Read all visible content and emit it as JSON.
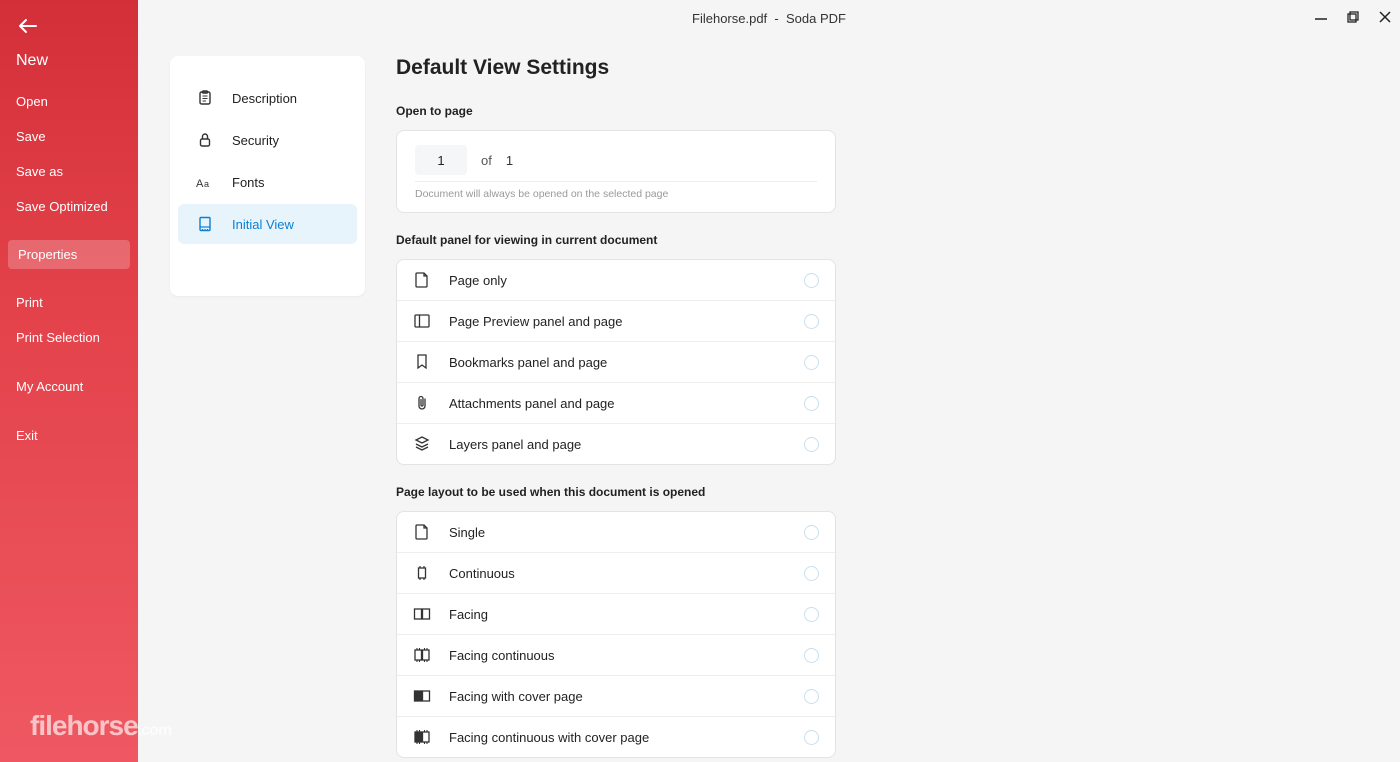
{
  "titlebar": {
    "document": "Filehorse.pdf",
    "separator": "-",
    "app": "Soda PDF"
  },
  "sidebar": {
    "items": [
      {
        "label": "New",
        "big": true
      },
      {
        "label": "Open"
      },
      {
        "label": "Save"
      },
      {
        "label": "Save as"
      },
      {
        "label": "Save Optimized"
      },
      {
        "label": "Properties",
        "active": true
      },
      {
        "label": "Print"
      },
      {
        "label": "Print Selection"
      },
      {
        "label": "My Account"
      },
      {
        "label": "Exit"
      }
    ]
  },
  "tabs": [
    {
      "label": "Description"
    },
    {
      "label": "Security"
    },
    {
      "label": "Fonts"
    },
    {
      "label": "Initial View",
      "active": true
    }
  ],
  "content": {
    "heading": "Default View Settings",
    "open_to_page": {
      "label": "Open to page",
      "value": "1",
      "of_text": "of",
      "total": "1",
      "hint": "Document will always be opened on the selected page"
    },
    "panel_section": {
      "label": "Default panel for viewing in current document",
      "options": [
        "Page only",
        "Page Preview panel and page",
        "Bookmarks panel and page",
        "Attachments panel and page",
        "Layers panel and page"
      ]
    },
    "layout_section": {
      "label": "Page layout to be used when this document is opened",
      "options": [
        "Single",
        "Continuous",
        "Facing",
        "Facing continuous",
        "Facing with cover page",
        "Facing continuous with cover page"
      ]
    }
  },
  "watermark": {
    "brand": "filehorse",
    "suffix": ".com"
  }
}
